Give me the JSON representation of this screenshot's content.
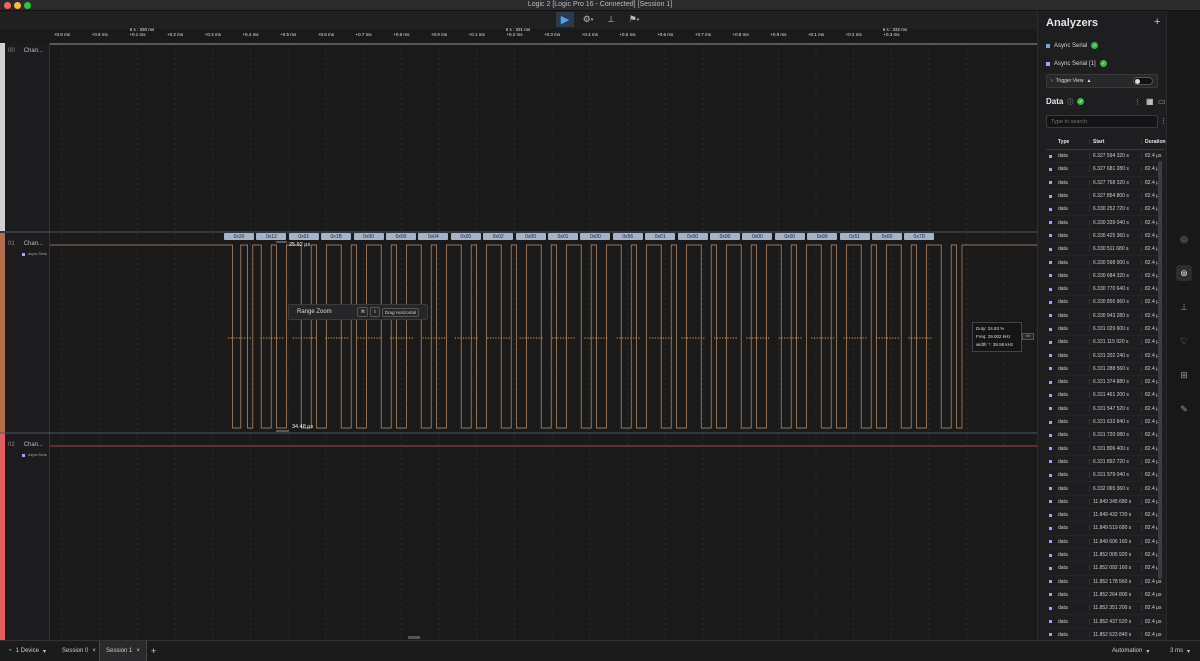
{
  "window": {
    "title": "Logic 2 [Logic Pro 16 - Connected] [Session 1]"
  },
  "ruler": {
    "group_labels": [
      {
        "text": "6 s : 330 ms",
        "at": 142
      },
      {
        "text": "6 s : 331 ms",
        "at": 518
      },
      {
        "text": "6 s : 332 ms",
        "at": 895
      }
    ],
    "ticks": [
      "+0.8 ms",
      "+0.9 ms",
      "+0.1 ms",
      "+0.2 ms",
      "+0.3 ms",
      "+0.4 ms",
      "+0.5 ms",
      "+0.6 ms",
      "+0.7 ms",
      "+0.8 ms",
      "+0.9 ms",
      "+0.1 ms",
      "+0.2 ms",
      "+0.3 ms",
      "+0.4 ms",
      "+0.5 ms",
      "+0.6 ms",
      "+0.7 ms",
      "+0.8 ms",
      "+0.9 ms",
      "+0.1 ms",
      "+0.2 ms",
      "+0.3 ms"
    ]
  },
  "channels": [
    {
      "num": "00",
      "name": "Chan...",
      "sub": ""
    },
    {
      "num": "01",
      "name": "Chan...",
      "sub": "Async Seria"
    },
    {
      "num": "02",
      "name": "Chan...",
      "sub": "Async Seria"
    }
  ],
  "decoded_bytes": [
    "0x20",
    "0x12",
    "0x01",
    "0x1B",
    "0x00",
    "0x00",
    "0x04",
    "0x00",
    "0x02",
    "0x00",
    "0x01",
    "0x00",
    "0x56",
    "0x01",
    "0x00",
    "0x00",
    "0x00",
    "0x00",
    "0x99",
    "0x51",
    "0x60",
    "0x7D"
  ],
  "measurements": {
    "top": "25.92 μs",
    "bottom": "34.48 μs"
  },
  "range_zoom": {
    "label": "Range Zoom",
    "k1": "⌘",
    "k2": "⇧",
    "drag": "Drag Horizontal"
  },
  "duty_tooltip": {
    "duty": "Duty: 24.83 %",
    "freq": "Freq: 29.002 kHz",
    "width": "width⁻¹: 38.58 kHz",
    "unit": "Hz"
  },
  "panel": {
    "title": "Analyzers",
    "analyzers": [
      {
        "name": "Async Serial",
        "color": "#7fa3d6"
      },
      {
        "name": "Async Serial [1]",
        "color": "#b597ff"
      }
    ],
    "trigger_label": "Trigger View",
    "data_title": "Data",
    "search_placeholder": "Type to search",
    "columns": [
      "Type",
      "Start",
      "Duration"
    ],
    "rows": [
      [
        "data",
        "6.327 594 320 s",
        "82.4 μs"
      ],
      [
        "data",
        "6.327 681 280 s",
        "82.4 μs"
      ],
      [
        "data",
        "6.327 768 320 s",
        "82.4 μs"
      ],
      [
        "data",
        "6.327 854 800 s",
        "82.4 μs"
      ],
      [
        "data",
        "6.330 252 720 s",
        "82.4 μs"
      ],
      [
        "data",
        "6.330 339 040 s",
        "82.4 μs"
      ],
      [
        "data",
        "6.330 425 360 s",
        "82.4 μs"
      ],
      [
        "data",
        "6.330 511 680 s",
        "82.4 μs"
      ],
      [
        "data",
        "6.330 598 000 s",
        "82.4 μs"
      ],
      [
        "data",
        "6.330 684 320 s",
        "82.4 μs"
      ],
      [
        "data",
        "6.330 770 640 s",
        "82.4 μs"
      ],
      [
        "data",
        "6.330 856 960 s",
        "82.4 μs"
      ],
      [
        "data",
        "6.330 943 280 s",
        "82.4 μs"
      ],
      [
        "data",
        "6.331 029 600 s",
        "82.4 μs"
      ],
      [
        "data",
        "6.331 115 920 s",
        "82.4 μs"
      ],
      [
        "data",
        "6.331 202 240 s",
        "82.4 μs"
      ],
      [
        "data",
        "6.331 288 560 s",
        "82.4 μs"
      ],
      [
        "data",
        "6.331 374 880 s",
        "82.4 μs"
      ],
      [
        "data",
        "6.331 461 200 s",
        "82.4 μs"
      ],
      [
        "data",
        "6.331 547 520 s",
        "82.4 μs"
      ],
      [
        "data",
        "6.331 633 840 s",
        "82.4 μs"
      ],
      [
        "data",
        "6.331 720 080 s",
        "82.4 μs"
      ],
      [
        "data",
        "6.331 806 400 s",
        "82.4 μs"
      ],
      [
        "data",
        "6.331 892 720 s",
        "82.4 μs"
      ],
      [
        "data",
        "6.331 979 040 s",
        "82.4 μs"
      ],
      [
        "data",
        "6.332 065 360 s",
        "82.4 μs"
      ],
      [
        "data",
        "11.849 345 680 s",
        "82.4 μs"
      ],
      [
        "data",
        "11.849 432 720 s",
        "82.4 μs"
      ],
      [
        "data",
        "11.849 519 680 s",
        "82.4 μs"
      ],
      [
        "data",
        "11.849 606 160 s",
        "82.4 μs"
      ],
      [
        "data",
        "11.852 005 920 s",
        "82.4 μs"
      ],
      [
        "data",
        "11.852 092 160 s",
        "82.4 μs"
      ],
      [
        "data",
        "11.852 178 560 s",
        "82.4 μs"
      ],
      [
        "data",
        "11.852 264 800 s",
        "82.4 μs"
      ],
      [
        "data",
        "11.852 351 200 s",
        "82.4 μs"
      ],
      [
        "data",
        "11.852 437 520 s",
        "82.4 μs"
      ],
      [
        "data",
        "11.852 523 840 s",
        "82.4 μs"
      ]
    ]
  },
  "status": {
    "device": "1 Device",
    "tab0": "Session 0",
    "tab1": "Session 1",
    "add": "+",
    "automation": "Automation",
    "timing": "3 ms"
  }
}
